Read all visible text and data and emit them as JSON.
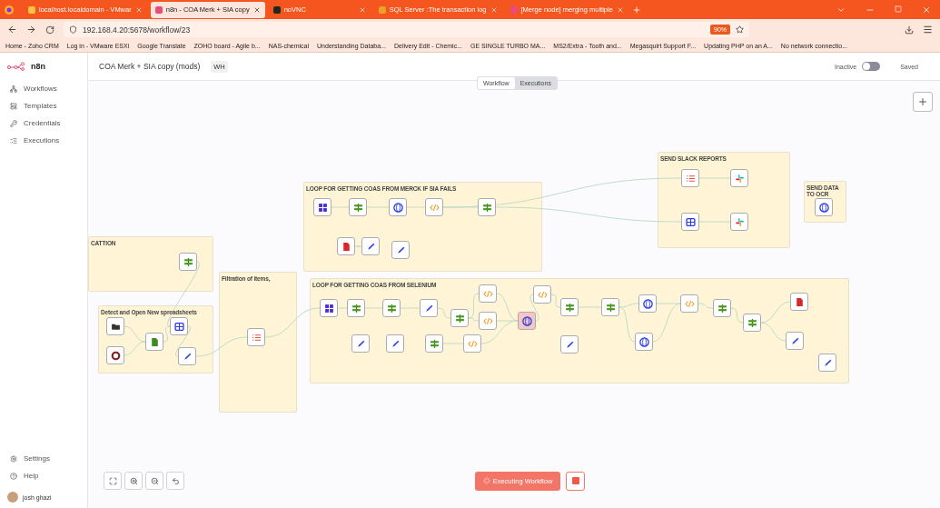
{
  "browser": {
    "tabs": [
      {
        "title": "localhost.localdomain - VMwar",
        "selected": false
      },
      {
        "title": "n8n - COA Merk + SIA copy",
        "selected": true
      },
      {
        "title": "noVNC",
        "selected": false
      },
      {
        "title": "SQL Server :The transaction log",
        "selected": false
      },
      {
        "title": "[Merge node] merging multiple",
        "selected": false
      }
    ],
    "url": "192.168.4.20:5678/workflow/23",
    "zoom": "90%",
    "bookmarks": [
      "Home - Zoho CRM",
      "Log in - VMware ESXi",
      "Google Translate",
      "ZOHO board - Agile b...",
      "NAS-chemical",
      "Understanding Databa...",
      "Delivery Edit - Chemic...",
      "GE SINGLE TURBO MA...",
      "MS2/Extra - Tooth and...",
      "Megasquirt Support F...",
      "Updating PHP on an A...",
      "No network connectio..."
    ]
  },
  "sidebar": {
    "brand": "n8n",
    "items": [
      "Workflows",
      "Templates",
      "Credentials",
      "Executions"
    ],
    "footer_items": [
      "Settings",
      "Help"
    ],
    "user": "josh ghazi"
  },
  "header": {
    "title": "COA Merk + SIA copy (mods)",
    "tag": "WH",
    "status": "Inactive",
    "active": false,
    "save_state": "Saved"
  },
  "view_tabs": [
    {
      "label": "Workflow",
      "selected": true
    },
    {
      "label": "Executions",
      "selected": false
    }
  ],
  "canvas": {
    "notes": [
      {
        "title": "SEND SLACK REPORTS",
        "nodes": [
          {
            "kind": "list",
            "running": false
          },
          {
            "kind": "slack",
            "running": false
          },
          {
            "kind": "table",
            "running": false
          },
          {
            "kind": "slack",
            "running": false
          }
        ]
      },
      {
        "title": "LOOP FOR GETTING COAS FROM MERCK IF SIA FAILS",
        "nodes": [
          {
            "kind": "split",
            "running": false
          },
          {
            "kind": "if",
            "running": false
          },
          {
            "kind": "http",
            "running": false
          },
          {
            "kind": "code",
            "running": false
          },
          {
            "kind": "if",
            "running": false
          },
          {
            "kind": "write",
            "running": false
          },
          {
            "kind": "set",
            "running": false
          },
          {
            "kind": "set",
            "running": false
          }
        ]
      },
      {
        "title": "SEND DATA TO OCR",
        "nodes": [
          {
            "kind": "http",
            "running": false
          }
        ]
      },
      {
        "title": "CATTION",
        "nodes": [
          {
            "kind": "if",
            "running": false
          }
        ]
      },
      {
        "title": "Filtration of items,",
        "nodes": [
          {
            "kind": "list",
            "running": false
          }
        ]
      },
      {
        "title": "LOOP FOR GETTING COAS FROM SELENIUM",
        "nodes": [
          {
            "kind": "split",
            "running": false
          },
          {
            "kind": "if",
            "running": false
          },
          {
            "kind": "if",
            "running": false
          },
          {
            "kind": "set",
            "running": false
          },
          {
            "kind": "code",
            "running": false
          },
          {
            "kind": "code",
            "running": false
          },
          {
            "kind": "if",
            "running": false
          },
          {
            "kind": "if",
            "running": false
          },
          {
            "kind": "http",
            "running": false
          },
          {
            "kind": "code",
            "running": false
          },
          {
            "kind": "if",
            "running": false
          },
          {
            "kind": "write",
            "running": false
          },
          {
            "kind": "if",
            "running": false
          },
          {
            "kind": "code",
            "running": false
          },
          {
            "kind": "http",
            "running": true
          },
          {
            "kind": "if",
            "running": false
          },
          {
            "kind": "set",
            "running": false
          },
          {
            "kind": "set",
            "running": false
          },
          {
            "kind": "if",
            "running": false
          },
          {
            "kind": "code",
            "running": false
          },
          {
            "kind": "set",
            "running": false
          },
          {
            "kind": "http",
            "running": false
          },
          {
            "kind": "set",
            "running": false
          },
          {
            "kind": "set",
            "running": false
          }
        ]
      },
      {
        "title": "Detect and Open New spreadsheets",
        "nodes": [
          {
            "kind": "trigger",
            "running": false
          },
          {
            "kind": "table",
            "running": false
          },
          {
            "kind": "file",
            "running": false
          },
          {
            "kind": "start",
            "running": false
          },
          {
            "kind": "set",
            "running": false
          }
        ]
      }
    ]
  },
  "run_button": "Executing Workflow"
}
